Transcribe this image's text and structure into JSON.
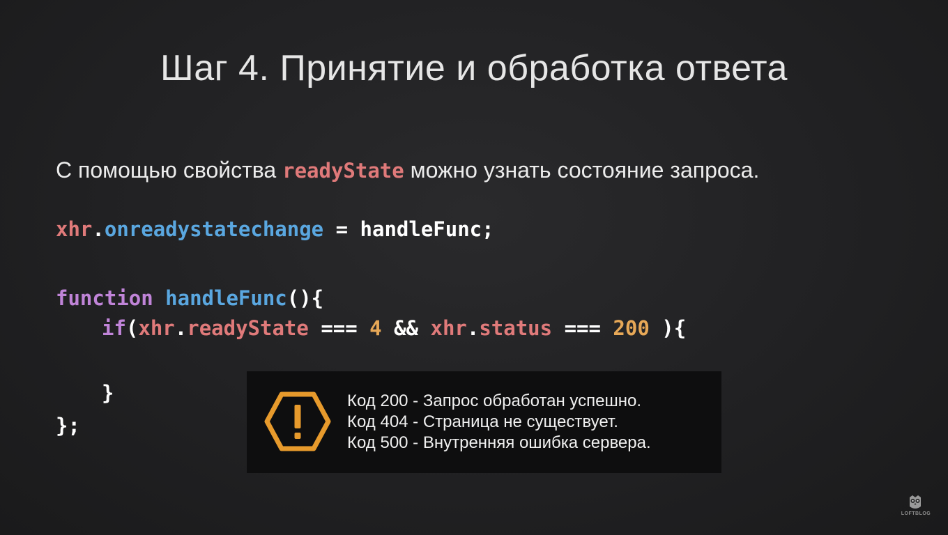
{
  "title": "Шаг 4.  Принятие и обработка ответа",
  "intro": {
    "before": "С помощью свойства ",
    "keyword": "readyState",
    "after": " можно узнать состояние запроса."
  },
  "code": {
    "line1": {
      "t1": "xhr",
      "t2": ".",
      "t3": "onreadystatechange",
      "t4": " = ",
      "t5": "handleFunc;"
    },
    "line2": {
      "t1": "function",
      "t2": " ",
      "t3": "handleFunc",
      "t4": "(){"
    },
    "line3": {
      "t1": "if",
      "t2": "(",
      "t3": "xhr",
      "t4": ".",
      "t5": "readyState",
      "t6": " === ",
      "t7": "4",
      "t8": " && ",
      "t9": "xhr",
      "t10": ".",
      "t11": "status",
      "t12": " === ",
      "t13": "200",
      "t14": " ){"
    },
    "line4": "}",
    "line5": "};"
  },
  "alert": {
    "icon": "warning-hexagon-icon",
    "lines": [
      "Код 200 - Запрос обработан успешно.",
      "Код 404 - Страница не существует.",
      "Код 500 - Внутренняя ошибка сервера."
    ]
  },
  "logo": {
    "text": "LOFTBLOG",
    "icon": "owl-logo-icon"
  },
  "colors": {
    "background": "#212123",
    "variable": "#e07a7a",
    "property": "#e07a7a",
    "method": "#5aa7e0",
    "keyword": "#c084d8",
    "number": "#e7a857",
    "plain": "#ffffff",
    "warning": "#e79a2c"
  }
}
